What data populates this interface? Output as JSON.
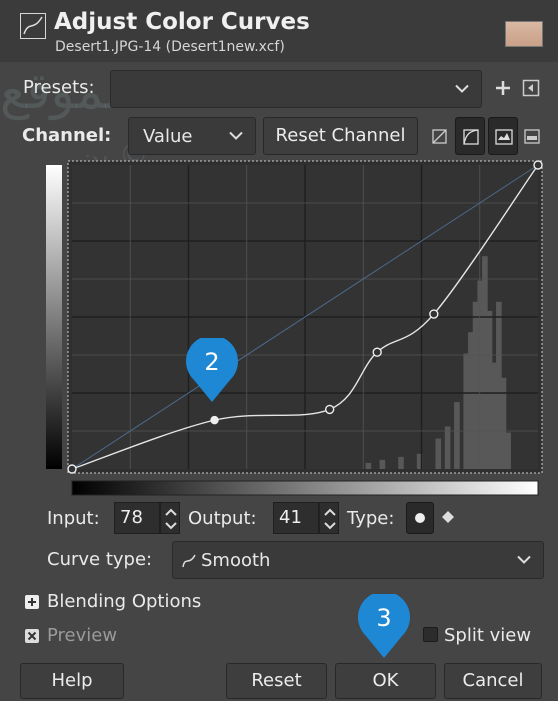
{
  "header": {
    "title": "Adjust Color Curves",
    "subtitle": "Desert1.JPG-14 (Desert1new.xcf)"
  },
  "watermark": {
    "line1": "الموقع",
    "line2": "ين ©"
  },
  "presets": {
    "label": "Presets:",
    "value": ""
  },
  "channel": {
    "label": "Channel:",
    "value": "Value",
    "reset_label": "Reset Channel"
  },
  "curve": {
    "input_label": "Input:",
    "input_value": "78",
    "output_label": "Output:",
    "output_value": "41",
    "type_label": "Type:",
    "curve_type_label": "Curve type:",
    "curve_type_value": "Smooth",
    "points": [
      [
        0,
        0
      ],
      [
        78,
        41
      ],
      [
        141,
        50
      ],
      [
        167,
        98
      ],
      [
        198,
        130
      ],
      [
        255,
        255
      ]
    ],
    "range": [
      0,
      255
    ]
  },
  "options": {
    "blending_label": "Blending Options",
    "preview_label": "Preview",
    "split_view_label": "Split view"
  },
  "buttons": {
    "help": "Help",
    "reset": "Reset",
    "ok": "OK",
    "cancel": "Cancel"
  },
  "badges": {
    "step2": "2",
    "step3": "3"
  },
  "colors": {
    "badge": "#1e88d4",
    "background": "#454545"
  }
}
